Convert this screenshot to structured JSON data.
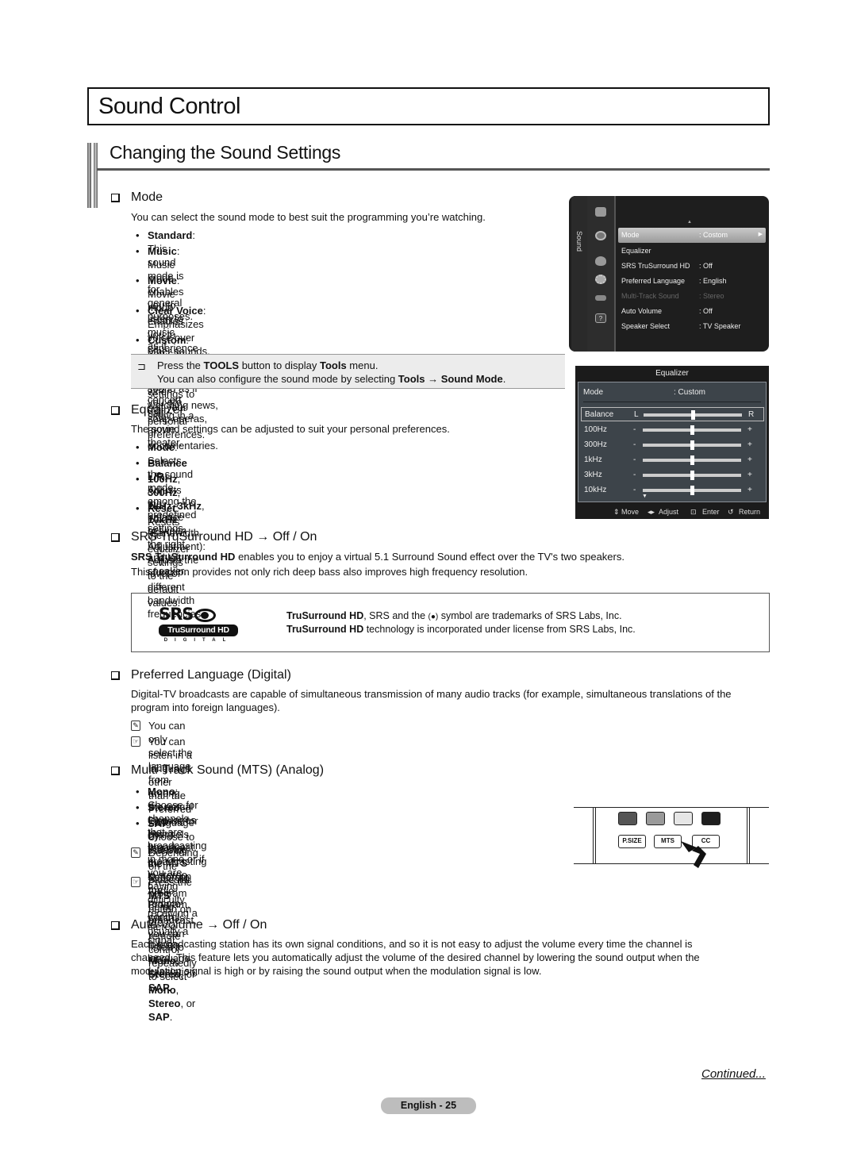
{
  "page": {
    "title": "Sound Control",
    "section_heading": "Changing the Sound Settings",
    "continued": "Continued...",
    "page_label": "English - 25"
  },
  "mode": {
    "heading": "Mode",
    "intro": "You can select the sound mode to best suit the programming you’re watching.",
    "bullets": [
      {
        "term": "Standard",
        "text": ": This sound mode is for general purposes."
      },
      {
        "term": "Music",
        "text": ": Music mode enables you to listen to music as if you are sitting",
        "text2": "in a concert hall."
      },
      {
        "term": "Movie",
        "text": ": Movie mode enables you to experience live and full movie sound as if you are",
        "text2": "sitting in a movie theater."
      },
      {
        "term": "Clear Voice",
        "text": ": Emphasizes voice over other sounds. Select this sound mode when",
        "text2": "watching news, soap operas, or documentaries."
      },
      {
        "term": "Custom",
        "text": ": You can customize the sound settings to suit your personal preferences."
      }
    ],
    "tools_note": {
      "icon": "tools-icon",
      "line1_pre": "Press the ",
      "line1_b1": "TOOLS",
      "line1_mid": " button to display ",
      "line1_b2": "Tools",
      "line1_post": " menu.",
      "line2_pre": "You can also configure the sound mode by selecting ",
      "line2_b1": "Tools",
      "line2_arrow": " → ",
      "line2_b2": "Sound Mode",
      "line2_post": "."
    }
  },
  "tv_menu": {
    "side_label": "Sound",
    "icons": [
      "picture-icon",
      "sound-icon",
      "channel-icon",
      "setup-icon",
      "input-icon",
      "support-icon"
    ],
    "items": [
      {
        "label": "Mode",
        "value": ": Costom",
        "selected": true
      },
      {
        "label": "Equalizer",
        "value": ""
      },
      {
        "label": "SRS TruSurround HD",
        "value": ": Off"
      },
      {
        "label": "Preferred Language",
        "value": ": English"
      },
      {
        "label": "Multi-Track Sound",
        "value": ": Stereo",
        "disabled": true
      },
      {
        "label": "Auto Volume",
        "value": ": Off"
      },
      {
        "label": "Speaker Select",
        "value": ": TV Speaker"
      }
    ]
  },
  "equalizer_screen": {
    "title": "Equalizer",
    "mode_label": "Mode",
    "mode_value": ": Custom",
    "rows": [
      {
        "label": "Balance",
        "low": "L",
        "high": "R",
        "level": 0.5,
        "selected": true
      },
      {
        "label": "100Hz",
        "low": "-",
        "high": "+",
        "level": 0.5
      },
      {
        "label": "300Hz",
        "low": "-",
        "high": "+",
        "level": 0.5
      },
      {
        "label": "1kHz",
        "low": "-",
        "high": "+",
        "level": 0.5
      },
      {
        "label": "3kHz",
        "low": "-",
        "high": "+",
        "level": 0.5
      },
      {
        "label": "10kHz",
        "low": "-",
        "high": "+",
        "level": 0.5
      }
    ],
    "footer": {
      "move": "Move",
      "adjust": "Adjust",
      "enter": "Enter",
      "return": "Return"
    }
  },
  "equalizer": {
    "heading": "Equalizer",
    "intro": "The sound settings can be adjusted to suit your personal preferences.",
    "bullets": [
      {
        "term": "Mode",
        "text": ": Selects the sound mode among the predefined settings."
      },
      {
        "term": "Balance L/R",
        "text": ": Adjusts the balance between the right and left speaker."
      },
      {
        "term": "100Hz",
        "text": ", ",
        "term2": "300Hz",
        "text_b": ", ",
        "term3": "1kHz",
        "text_c": ", ",
        "term4": "3kHz",
        "text_d": ", ",
        "term5": "10kHz",
        "text_e": " (Bandwidth Adjustment): Adjusts the level of",
        "text2": "different bandwidth frequencies."
      },
      {
        "term": "Reset",
        "text": ": Resets the equalizer settings to the default values."
      }
    ]
  },
  "srs": {
    "heading": "SRS TruSurround HD → Off / On",
    "p1_term": "SRS TruSurround HD",
    "p1_text": " enables you to enjoy a virtual 5.1 Surround Sound effect over the TV's two speakers.",
    "p2": "This function provides not only rich deep bass also improves high frequency resolution.",
    "logo_srs": "SRS",
    "logo_pill": "TruSurround HD",
    "logo_digital": "DIGITAL",
    "tm1_term": "TruSurround HD",
    "tm1_text": ", SRS and the ",
    "tm1_text2": " symbol are trademarks of SRS Labs, Inc.",
    "tm2_term": "TruSurround HD",
    "tm2_text": " technology is incorporated under license from SRS Labs, Inc."
  },
  "preferred_language": {
    "heading": "Preferred Language (Digital)",
    "p1": "Digital-TV broadcasts are capable of simultaneous transmission of many audio tracks (for example, simultaneous translations of the",
    "p2": "program into foreign languages).",
    "note1": "You can only select the language from among the actual languages being broadcast.",
    "note2_pre": "You can listen in a language other than the Preferred Language by pressing the ",
    "note2_b": "MTS",
    "note2_post": " button on the remote control."
  },
  "mts": {
    "heading": "Multi-Track Sound (MTS) (Analog)",
    "bullets": [
      {
        "term": "Mono",
        "text": ": Choose for channels that are broadcasting in mono or if you are having difficulty receiving a stereo signal."
      },
      {
        "term": "Stereo",
        "text": ": Choose for channels that are broadcasting in stereo."
      },
      {
        "term": "SAP",
        "text": ": Choose to listen to the Separate Audio Program, which is usually a foreign-",
        "text2": "language translation."
      }
    ],
    "note1_pre": "Depending on the particular program being broadcast, you can listen to ",
    "note1_b1": "Mono,",
    "note1_l2_b": "Stereo,",
    "note1_l2_mid": " or ",
    "note1_l2_b2": "SAP.",
    "note2_pre": "Press the ",
    "note2_b1": "MTS",
    "note2_mid": " button on the remote control repeatedly to select ",
    "note2_b2": "Mono",
    "note2_c": ", ",
    "note2_b3": "Stereo",
    "note2_post": ", or",
    "note2_l2_b": "SAP",
    "note2_l2_post": ".",
    "remote": {
      "color_buttons": [
        "#555555",
        "#9a9a9a",
        "#e6e6e6",
        "#1e1e1e"
      ],
      "buttons": [
        "P.SIZE",
        "MTS",
        "CC"
      ]
    }
  },
  "auto_volume": {
    "heading": "Auto Volume → Off / On",
    "p1": "Each broadcasting station has its own signal conditions, and so it is not easy to adjust the volume every time the channel is",
    "p2": "changed. This feature lets you automatically adjust the volume of the desired channel by lowering the sound output when the",
    "p3": "modulation signal is high or by raising the sound output when the modulation signal is low."
  }
}
